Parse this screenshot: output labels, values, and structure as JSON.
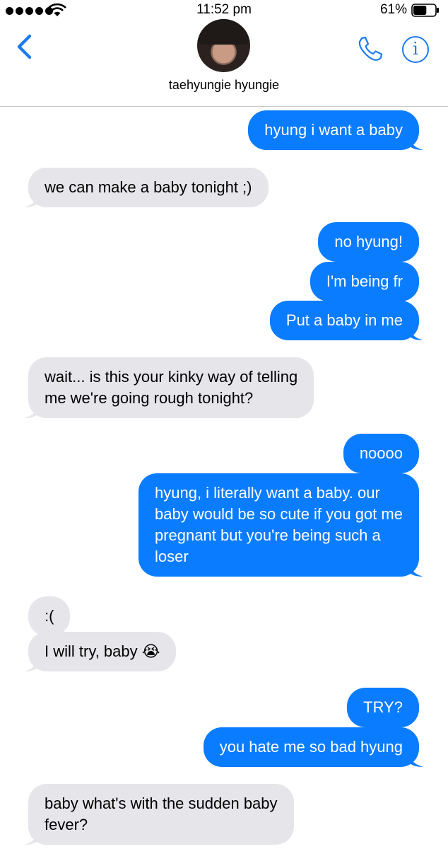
{
  "status_bar": {
    "time": "11:52 pm",
    "battery": "61%",
    "battery_level": 0.61
  },
  "header": {
    "contact_name": "taehyungie hyungie",
    "icons": [
      "back-chevron-icon",
      "avatar",
      "phone-icon",
      "info-icon"
    ]
  },
  "colors": {
    "outgoing": "#0a7cff",
    "incoming": "#e5e5ea",
    "accent": "#1b7bf0"
  },
  "messages": [
    {
      "side": "out",
      "text": "hyung i want a baby"
    },
    {
      "side": "in",
      "text": "we can make a baby tonight ;)"
    },
    {
      "side": "out",
      "text": "no hyung!"
    },
    {
      "side": "out",
      "text": "I'm being fr"
    },
    {
      "side": "out",
      "text": "Put a baby in me"
    },
    {
      "side": "in",
      "text": "wait... is this your kinky way of telling\nme we're going rough tonight?"
    },
    {
      "side": "out",
      "text": "noooo"
    },
    {
      "side": "out",
      "text": "hyung, i literally want a baby. our\nbaby would be so cute if you got me\npregnant but you're being such a\nloser"
    },
    {
      "side": "in",
      "text": ":("
    },
    {
      "side": "in",
      "text": "I will try, baby 😭"
    },
    {
      "side": "out",
      "text": "TRY?"
    },
    {
      "side": "out",
      "text": "you hate me so bad hyung"
    },
    {
      "side": "in",
      "text": "baby what's with the sudden baby\nfever?"
    }
  ]
}
